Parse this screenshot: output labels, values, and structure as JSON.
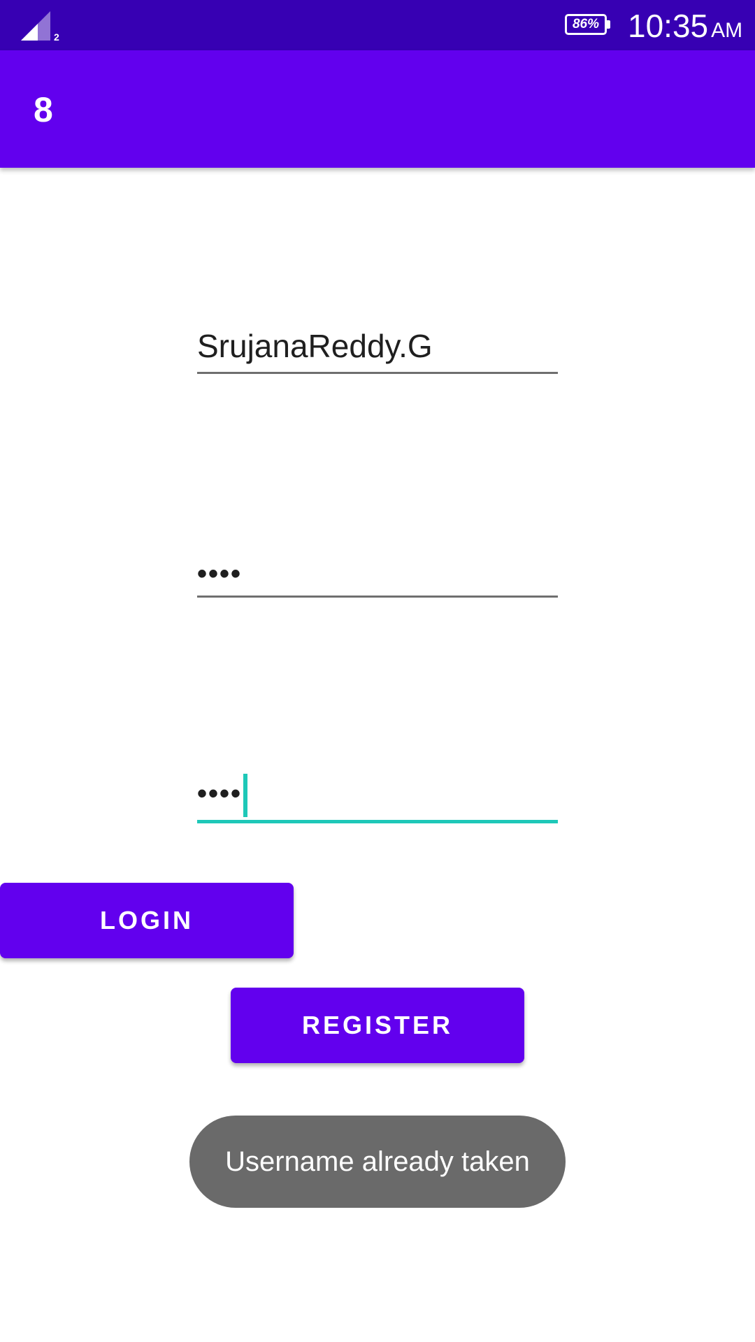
{
  "status_bar": {
    "signal_sim": "2",
    "battery_percent": "86%",
    "time": "10:35",
    "ampm": "AM",
    "colors": {
      "background": "#3700b3"
    }
  },
  "app_bar": {
    "title": "8",
    "colors": {
      "background": "#6200ee"
    }
  },
  "form": {
    "username_value": "SrujanaReddy.G",
    "password_value": "••••",
    "confirm_password_value": "••••",
    "focused_field": "confirm_password",
    "accent_color": "#1ec8b8"
  },
  "buttons": {
    "login_label": "LOGIN",
    "register_label": "REGISTER",
    "color": "#6200ee"
  },
  "toast": {
    "message": "Username already taken"
  },
  "icons": {
    "signal": "cellular-signal-icon",
    "battery": "battery-icon"
  }
}
